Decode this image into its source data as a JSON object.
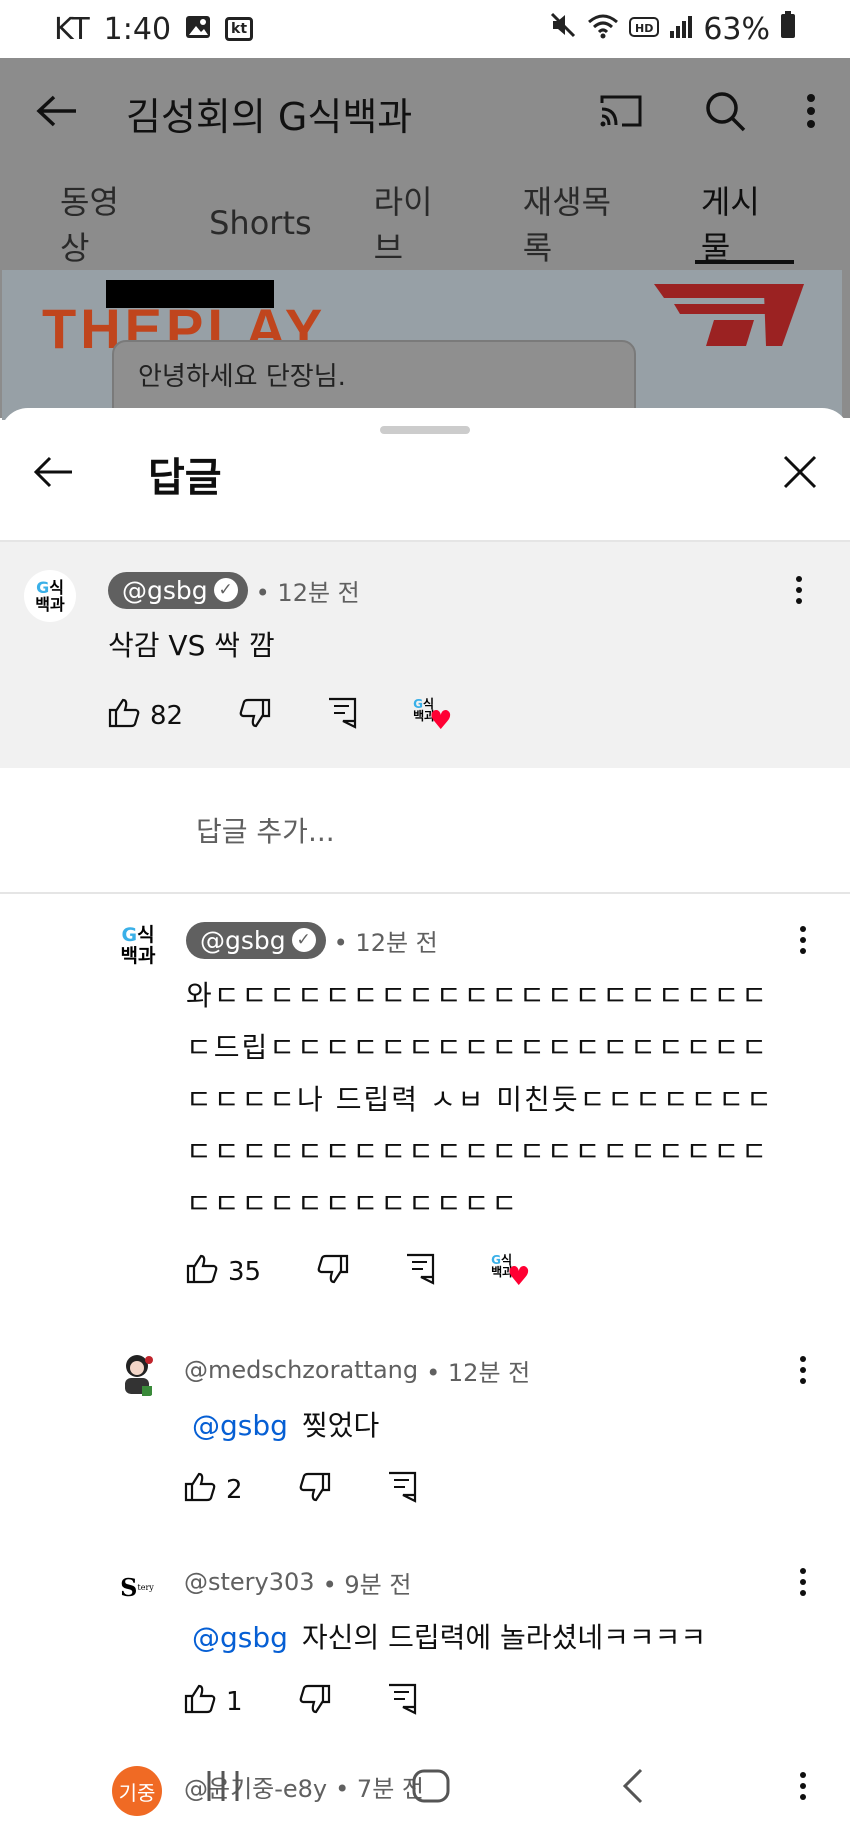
{
  "status": {
    "carrier": "KT",
    "time": "1:40",
    "kt_badge": "kt",
    "battery": "63%"
  },
  "channel": {
    "title": "김성회의 G식백과",
    "tabs": [
      {
        "label": "동영상"
      },
      {
        "label": "Shorts"
      },
      {
        "label": "라이브"
      },
      {
        "label": "재생목록"
      },
      {
        "label": "게시물"
      }
    ],
    "banner": {
      "logo_text": "THEPLAY",
      "bubble_text": "안녕하세요 단장님."
    }
  },
  "sheet": {
    "title": "답글",
    "add_reply_placeholder": "답글 추가...",
    "avatar_letter": "G",
    "avatar_text": "식",
    "avatar_line2": "백과"
  },
  "parent": {
    "handle": "@gsbg",
    "time": "• 12분 전",
    "text": "삭감 VS 싹 깜",
    "likes": "82"
  },
  "replies": [
    {
      "handle": "@gsbg",
      "time": "• 12분 전",
      "text": "와ㄷㄷㄷㄷㄷㄷㄷㄷㄷㄷㄷㄷㄷㄷㄷㄷㄷㄷㄷㄷㄷ드립ㄷㄷㄷㄷㄷㄷㄷㄷㄷㄷㄷㄷㄷㄷㄷㄷㄷㄷㄷㄷㄷㄷ나 드립력 ㅅㅂ 미친듯ㄷㄷㄷㄷㄷㄷㄷㄷㄷㄷㄷㄷㄷㄷㄷㄷㄷㄷㄷㄷㄷㄷㄷㄷㄷㄷㄷㄷㄷㄷㄷㄷㄷㄷㄷㄷㄷㄷㄷㄷ",
      "likes": "35"
    },
    {
      "handle": "@medschzorattang",
      "time": "• 12분 전",
      "mention": "@gsbg",
      "text": "찢었다",
      "likes": "2"
    },
    {
      "handle": "@stery303",
      "time": "• 9분 전",
      "mention": "@gsbg",
      "text": "자신의 드립력에 놀라셨네ㅋㅋㅋㅋ",
      "likes": "1",
      "avatar_text": "S",
      "avatar_small": "tery"
    },
    {
      "handle": "@윤기중-e8y",
      "time": "• 7분 전",
      "avatar_text": "기중"
    }
  ],
  "colors": {
    "link": "#065fd4",
    "heart": "#ff0033",
    "avatar_orange": "#f06a24"
  }
}
